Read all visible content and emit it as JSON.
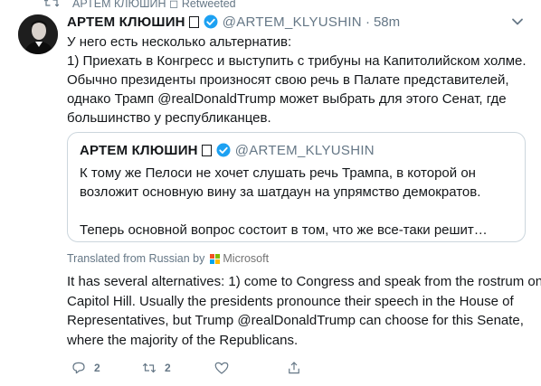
{
  "retweet_context": {
    "text": "АРТЕМ КЛЮШИН ◻ Retweeted"
  },
  "tweet": {
    "author_name": "АРТЕМ КЛЮШИН",
    "handle": "@ARTEM_KLYUSHIN",
    "separator": "·",
    "time": "58m",
    "lines": [
      "У него есть несколько альтернатив:",
      "1) Приехать в Конгресс и выступить с трибуны на Капитолийском холме.",
      "Обычно президенты произносят свою речь в Палате представителей,",
      "однако Трамп @realDonaldTrump может выбрать для этого Сенат, где",
      "большинство у республиканцев."
    ]
  },
  "quoted_tweet": {
    "author_name": "АРТЕМ КЛЮШИН",
    "handle": "@ARTEM_KLYUSHIN",
    "lines": [
      "К тому же Пелоси не хочет слушать речь Трампа, в которой он",
      "возложит основную вину за шатдаун на упрямство демократов.",
      "Теперь основной вопрос состоит в том, что же все-таки решит…"
    ]
  },
  "translation": {
    "label": "Translated from Russian by",
    "provider": "Microsoft",
    "lines": [
      "It has several alternatives: 1) come to Congress and speak from the rostrum on",
      "Capitol Hill. Usually the presidents pronounce their speech in the House of",
      "Representatives, but Trump @realDonaldTrump can choose for this Senate,",
      "where the majority of the Republicans."
    ]
  },
  "actions": {
    "reply_count": "2",
    "retweet_count": "2",
    "like_count": "",
    "share_count": ""
  },
  "colors": {
    "verified": "#1da1f2",
    "secondary_text": "#657786",
    "border": "#ccd6dd",
    "ms_red": "#f25022",
    "ms_green": "#7fba00",
    "ms_blue": "#00a4ef",
    "ms_yellow": "#ffb900"
  },
  "icons": {
    "retweet_context": "retweet-icon",
    "verified": "verified-badge-icon",
    "caret": "chevron-down-icon",
    "reply": "reply-icon",
    "retweet": "retweet-icon",
    "like": "heart-icon",
    "share": "share-icon",
    "provider_logo": "microsoft-logo-icon"
  }
}
